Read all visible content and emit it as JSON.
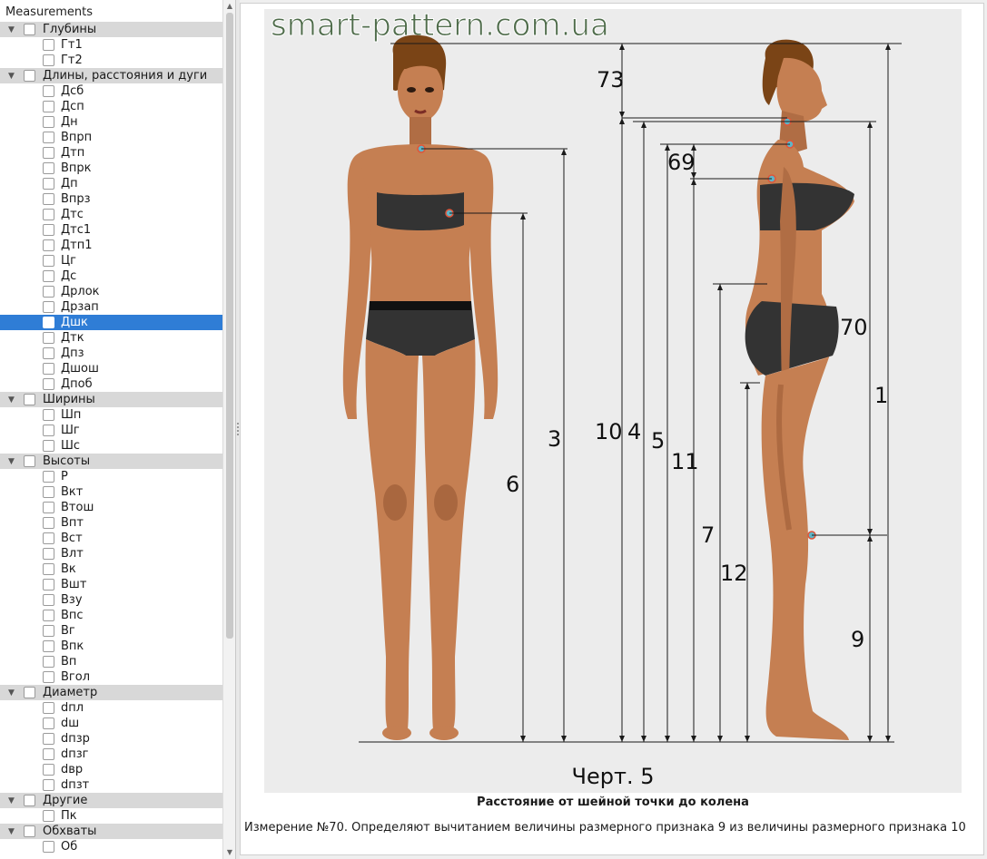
{
  "tree": {
    "header": "Measurements",
    "rows": [
      {
        "type": "group",
        "label": "Глубины"
      },
      {
        "type": "item",
        "label": "Гт1"
      },
      {
        "type": "item",
        "label": "Гт2"
      },
      {
        "type": "group",
        "label": "Длины, расстояния и дуги"
      },
      {
        "type": "item",
        "label": "Дсб"
      },
      {
        "type": "item",
        "label": "Дсп"
      },
      {
        "type": "item",
        "label": "Дн"
      },
      {
        "type": "item",
        "label": "Впрп"
      },
      {
        "type": "item",
        "label": "Дтп"
      },
      {
        "type": "item",
        "label": "Впрк"
      },
      {
        "type": "item",
        "label": "Дп"
      },
      {
        "type": "item",
        "label": "Впрз"
      },
      {
        "type": "item",
        "label": "Дтс"
      },
      {
        "type": "item",
        "label": "Дтс1"
      },
      {
        "type": "item",
        "label": "Дтп1"
      },
      {
        "type": "item",
        "label": "Цг"
      },
      {
        "type": "item",
        "label": "Дс"
      },
      {
        "type": "item",
        "label": "Дрлок"
      },
      {
        "type": "item",
        "label": "Дрзап"
      },
      {
        "type": "item",
        "label": "Дшк",
        "selected": true
      },
      {
        "type": "item",
        "label": "Дтк"
      },
      {
        "type": "item",
        "label": "Дпз"
      },
      {
        "type": "item",
        "label": "Дшош"
      },
      {
        "type": "item",
        "label": "Дпоб"
      },
      {
        "type": "group",
        "label": "Ширины"
      },
      {
        "type": "item",
        "label": "Шп"
      },
      {
        "type": "item",
        "label": "Шг"
      },
      {
        "type": "item",
        "label": "Шс"
      },
      {
        "type": "group",
        "label": "Высоты"
      },
      {
        "type": "item",
        "label": "Р"
      },
      {
        "type": "item",
        "label": "Вкт"
      },
      {
        "type": "item",
        "label": "Втош"
      },
      {
        "type": "item",
        "label": "Впт"
      },
      {
        "type": "item",
        "label": "Вст"
      },
      {
        "type": "item",
        "label": "Влт"
      },
      {
        "type": "item",
        "label": "Вк"
      },
      {
        "type": "item",
        "label": "Вшт"
      },
      {
        "type": "item",
        "label": "Взу"
      },
      {
        "type": "item",
        "label": "Впс"
      },
      {
        "type": "item",
        "label": "Вг"
      },
      {
        "type": "item",
        "label": "Впк"
      },
      {
        "type": "item",
        "label": "Вп"
      },
      {
        "type": "item",
        "label": "Вгол"
      },
      {
        "type": "group",
        "label": "Диаметр"
      },
      {
        "type": "item",
        "label": "dпл"
      },
      {
        "type": "item",
        "label": "dш"
      },
      {
        "type": "item",
        "label": "dпзр"
      },
      {
        "type": "item",
        "label": "dпзг"
      },
      {
        "type": "item",
        "label": "dвр"
      },
      {
        "type": "item",
        "label": "dпзт"
      },
      {
        "type": "group",
        "label": "Другие"
      },
      {
        "type": "item",
        "label": "Пк"
      },
      {
        "type": "group",
        "label": "Обхваты"
      },
      {
        "type": "item",
        "label": "Об"
      }
    ]
  },
  "figure": {
    "watermark": "smart-pattern.com.ua",
    "chart_title": "Черт. 5",
    "dimension_labels": [
      "73",
      "69",
      "70",
      "3",
      "6",
      "10",
      "4",
      "5",
      "11",
      "7",
      "12",
      "1",
      "9"
    ],
    "colors": {
      "background": "#ececec",
      "skin": "#c57f52",
      "skin_shadow": "#9c5c37",
      "underwear": "#333333",
      "hair": "#7a4416",
      "watermark": "#3f5f3a",
      "marker": "#e0553a",
      "marker_fill": "#5fb5c7",
      "selection": "#2f7dd6"
    }
  },
  "caption": "Расстояние от шейной точки до колена",
  "description": "Измерение №70. Определяют вычитанием величины размерного признака 9 из величины размерного признака 10"
}
